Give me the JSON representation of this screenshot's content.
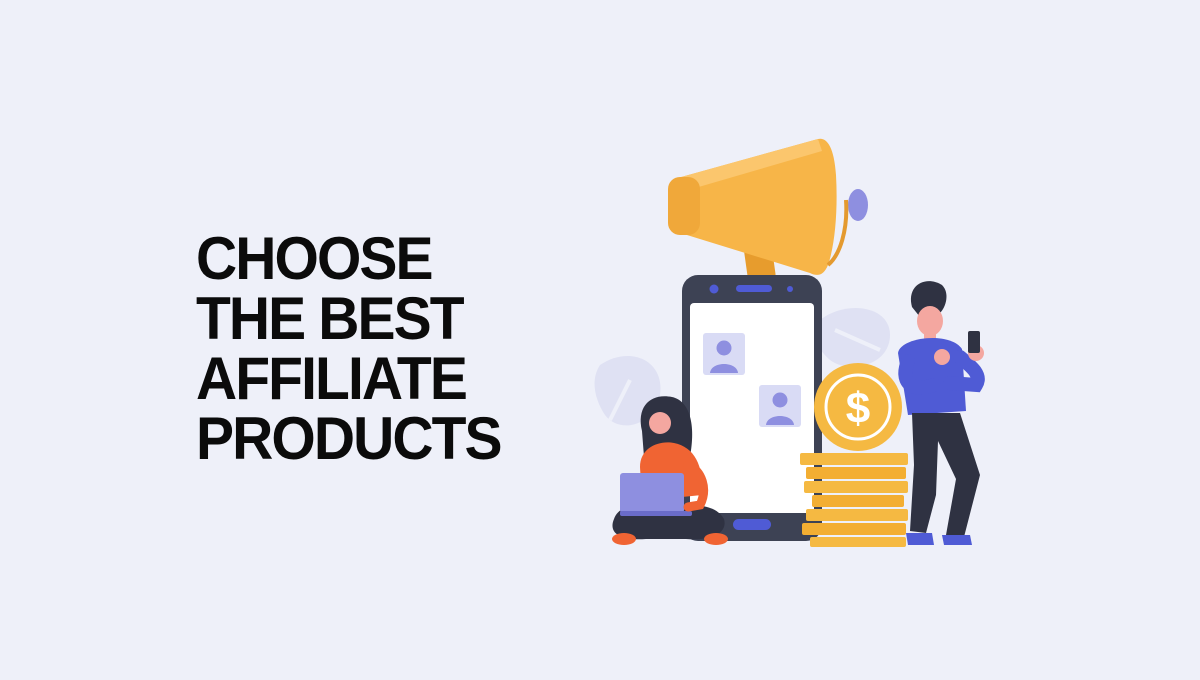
{
  "headline": {
    "lines": [
      "CHOOSE",
      "THE BEST",
      "AFFILIATE",
      "PRODUCTS"
    ]
  },
  "illustration": {
    "coin_symbol": "$",
    "icons": {
      "megaphone": "megaphone-icon",
      "smartphone": "smartphone-icon",
      "profile_card": "profile-card-icon",
      "coin": "dollar-coin-icon",
      "coin_stack": "coin-stack-icon",
      "leaf": "leaf-icon",
      "woman_with_laptop": "woman-with-laptop",
      "man_with_phone": "man-with-phone"
    },
    "colors": {
      "background": "#eef0f9",
      "headline": "#0b0b0b",
      "megaphone": "#f7b548",
      "coin": "#f5b942",
      "phone_frame": "#3d4254",
      "accent_blue": "#4f5bd5",
      "profile_purple": "#8e8fe0",
      "woman_top": "#f06433",
      "leaf": "#dfe1f3"
    }
  }
}
